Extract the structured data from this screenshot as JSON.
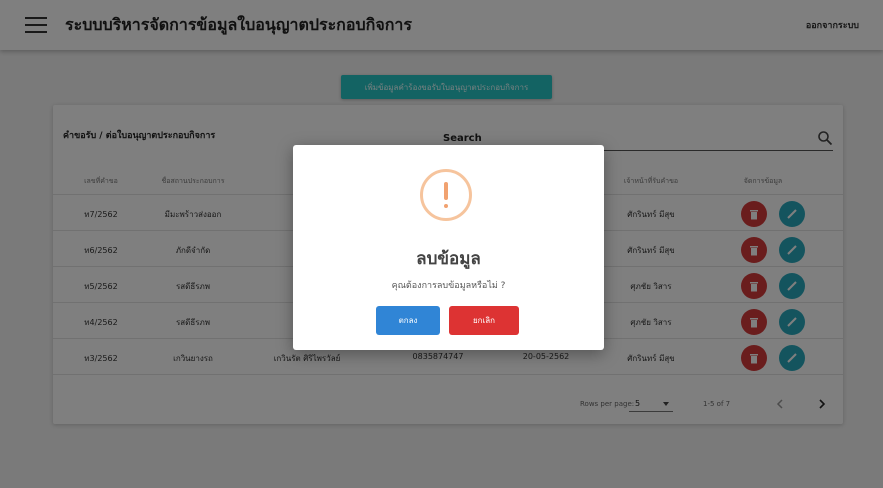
{
  "header": {
    "title": "ระบบบริหารจัดการข้อมูลใบอนุญาตประกอบกิจการ",
    "logout_label": "ออกจากระบบ",
    "menu_icon": "hamburger-menu-icon"
  },
  "toolbar": {
    "add_label": "เพิ่มข้อมูลคำร้องขอรับใบอนุญาตประกอบกิจการ"
  },
  "table": {
    "title": "คำขอรับ / ต่อใบอนุญาตประกอบกิจการ",
    "search_label": "Search",
    "search_value": "",
    "columns": [
      "เลขที่คำขอ",
      "ชื่อสถานประกอบการ",
      "",
      "",
      "",
      "เจ้าหน้าที่รับคำขอ",
      "จัดการข้อมูล"
    ],
    "rows": [
      {
        "req_no": "ท7/2562",
        "business": "มีมะพร้าวส่งออก",
        "owner": "ส",
        "phone": "",
        "date": "",
        "officer": "ศักรินทร์ มีสุข"
      },
      {
        "req_no": "ท6/2562",
        "business": "ภักดีจำกัด",
        "owner": "",
        "phone": "",
        "date": "",
        "officer": "ศักรินทร์ มีสุข"
      },
      {
        "req_no": "ท5/2562",
        "business": "รสดีธีรภพ",
        "owner": "",
        "phone": "",
        "date": "",
        "officer": "ศุภชัย วิสาร"
      },
      {
        "req_no": "ท4/2562",
        "business": "รสดีธีรภพ",
        "owner": "",
        "phone": "",
        "date": "",
        "officer": "ศุภชัย วิสาร"
      },
      {
        "req_no": "ท3/2562",
        "business": "เกวินยางรถ",
        "owner": "เกวินรัต ศิริไพรวัลย์",
        "phone": "0835874747",
        "date": "20-05-2562",
        "officer": "ศักรินทร์ มีสุข"
      }
    ],
    "actions": {
      "delete_icon": "trash-icon",
      "edit_icon": "pencil-icon"
    },
    "pagination": {
      "rows_per_page_label": "Rows per page:",
      "rows_per_page_value": "5",
      "range_text": "1-5 of 7"
    }
  },
  "dialog": {
    "icon": "warning-icon",
    "title": "ลบข้อมูล",
    "message": "คุณต้องการลบข้อมูลหรือไม่ ?",
    "confirm_label": "ตกลง",
    "cancel_label": "ยกเลิก"
  },
  "colors": {
    "accent": "#26c6c6",
    "delete": "#d43a3a",
    "edit": "#29a9bd",
    "confirm": "#3085d6",
    "cancel": "#dd3333",
    "warning": "#f1a270"
  }
}
